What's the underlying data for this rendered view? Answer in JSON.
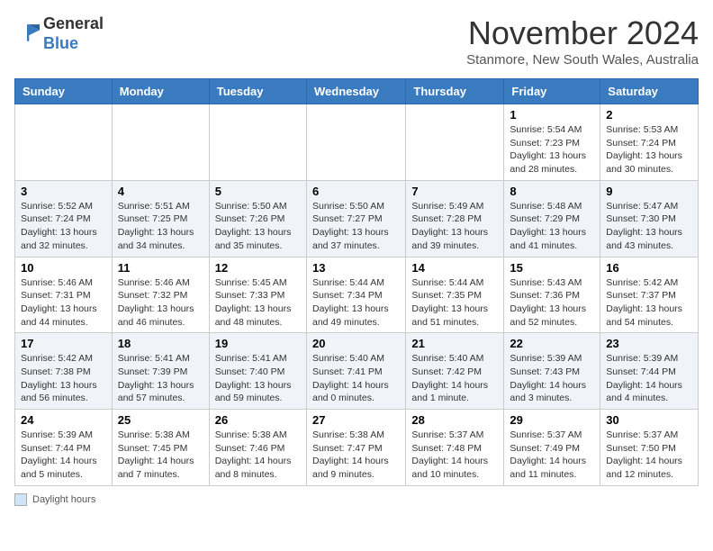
{
  "logo": {
    "text_general": "General",
    "text_blue": "Blue"
  },
  "header": {
    "month_year": "November 2024",
    "location": "Stanmore, New South Wales, Australia"
  },
  "days_of_week": [
    "Sunday",
    "Monday",
    "Tuesday",
    "Wednesday",
    "Thursday",
    "Friday",
    "Saturday"
  ],
  "weeks": [
    [
      {
        "day": "",
        "sunrise": "",
        "sunset": "",
        "daylight": ""
      },
      {
        "day": "",
        "sunrise": "",
        "sunset": "",
        "daylight": ""
      },
      {
        "day": "",
        "sunrise": "",
        "sunset": "",
        "daylight": ""
      },
      {
        "day": "",
        "sunrise": "",
        "sunset": "",
        "daylight": ""
      },
      {
        "day": "",
        "sunrise": "",
        "sunset": "",
        "daylight": ""
      },
      {
        "day": "1",
        "sunrise": "Sunrise: 5:54 AM",
        "sunset": "Sunset: 7:23 PM",
        "daylight": "Daylight: 13 hours and 28 minutes."
      },
      {
        "day": "2",
        "sunrise": "Sunrise: 5:53 AM",
        "sunset": "Sunset: 7:24 PM",
        "daylight": "Daylight: 13 hours and 30 minutes."
      }
    ],
    [
      {
        "day": "3",
        "sunrise": "Sunrise: 5:52 AM",
        "sunset": "Sunset: 7:24 PM",
        "daylight": "Daylight: 13 hours and 32 minutes."
      },
      {
        "day": "4",
        "sunrise": "Sunrise: 5:51 AM",
        "sunset": "Sunset: 7:25 PM",
        "daylight": "Daylight: 13 hours and 34 minutes."
      },
      {
        "day": "5",
        "sunrise": "Sunrise: 5:50 AM",
        "sunset": "Sunset: 7:26 PM",
        "daylight": "Daylight: 13 hours and 35 minutes."
      },
      {
        "day": "6",
        "sunrise": "Sunrise: 5:50 AM",
        "sunset": "Sunset: 7:27 PM",
        "daylight": "Daylight: 13 hours and 37 minutes."
      },
      {
        "day": "7",
        "sunrise": "Sunrise: 5:49 AM",
        "sunset": "Sunset: 7:28 PM",
        "daylight": "Daylight: 13 hours and 39 minutes."
      },
      {
        "day": "8",
        "sunrise": "Sunrise: 5:48 AM",
        "sunset": "Sunset: 7:29 PM",
        "daylight": "Daylight: 13 hours and 41 minutes."
      },
      {
        "day": "9",
        "sunrise": "Sunrise: 5:47 AM",
        "sunset": "Sunset: 7:30 PM",
        "daylight": "Daylight: 13 hours and 43 minutes."
      }
    ],
    [
      {
        "day": "10",
        "sunrise": "Sunrise: 5:46 AM",
        "sunset": "Sunset: 7:31 PM",
        "daylight": "Daylight: 13 hours and 44 minutes."
      },
      {
        "day": "11",
        "sunrise": "Sunrise: 5:46 AM",
        "sunset": "Sunset: 7:32 PM",
        "daylight": "Daylight: 13 hours and 46 minutes."
      },
      {
        "day": "12",
        "sunrise": "Sunrise: 5:45 AM",
        "sunset": "Sunset: 7:33 PM",
        "daylight": "Daylight: 13 hours and 48 minutes."
      },
      {
        "day": "13",
        "sunrise": "Sunrise: 5:44 AM",
        "sunset": "Sunset: 7:34 PM",
        "daylight": "Daylight: 13 hours and 49 minutes."
      },
      {
        "day": "14",
        "sunrise": "Sunrise: 5:44 AM",
        "sunset": "Sunset: 7:35 PM",
        "daylight": "Daylight: 13 hours and 51 minutes."
      },
      {
        "day": "15",
        "sunrise": "Sunrise: 5:43 AM",
        "sunset": "Sunset: 7:36 PM",
        "daylight": "Daylight: 13 hours and 52 minutes."
      },
      {
        "day": "16",
        "sunrise": "Sunrise: 5:42 AM",
        "sunset": "Sunset: 7:37 PM",
        "daylight": "Daylight: 13 hours and 54 minutes."
      }
    ],
    [
      {
        "day": "17",
        "sunrise": "Sunrise: 5:42 AM",
        "sunset": "Sunset: 7:38 PM",
        "daylight": "Daylight: 13 hours and 56 minutes."
      },
      {
        "day": "18",
        "sunrise": "Sunrise: 5:41 AM",
        "sunset": "Sunset: 7:39 PM",
        "daylight": "Daylight: 13 hours and 57 minutes."
      },
      {
        "day": "19",
        "sunrise": "Sunrise: 5:41 AM",
        "sunset": "Sunset: 7:40 PM",
        "daylight": "Daylight: 13 hours and 59 minutes."
      },
      {
        "day": "20",
        "sunrise": "Sunrise: 5:40 AM",
        "sunset": "Sunset: 7:41 PM",
        "daylight": "Daylight: 14 hours and 0 minutes."
      },
      {
        "day": "21",
        "sunrise": "Sunrise: 5:40 AM",
        "sunset": "Sunset: 7:42 PM",
        "daylight": "Daylight: 14 hours and 1 minute."
      },
      {
        "day": "22",
        "sunrise": "Sunrise: 5:39 AM",
        "sunset": "Sunset: 7:43 PM",
        "daylight": "Daylight: 14 hours and 3 minutes."
      },
      {
        "day": "23",
        "sunrise": "Sunrise: 5:39 AM",
        "sunset": "Sunset: 7:44 PM",
        "daylight": "Daylight: 14 hours and 4 minutes."
      }
    ],
    [
      {
        "day": "24",
        "sunrise": "Sunrise: 5:39 AM",
        "sunset": "Sunset: 7:44 PM",
        "daylight": "Daylight: 14 hours and 5 minutes."
      },
      {
        "day": "25",
        "sunrise": "Sunrise: 5:38 AM",
        "sunset": "Sunset: 7:45 PM",
        "daylight": "Daylight: 14 hours and 7 minutes."
      },
      {
        "day": "26",
        "sunrise": "Sunrise: 5:38 AM",
        "sunset": "Sunset: 7:46 PM",
        "daylight": "Daylight: 14 hours and 8 minutes."
      },
      {
        "day": "27",
        "sunrise": "Sunrise: 5:38 AM",
        "sunset": "Sunset: 7:47 PM",
        "daylight": "Daylight: 14 hours and 9 minutes."
      },
      {
        "day": "28",
        "sunrise": "Sunrise: 5:37 AM",
        "sunset": "Sunset: 7:48 PM",
        "daylight": "Daylight: 14 hours and 10 minutes."
      },
      {
        "day": "29",
        "sunrise": "Sunrise: 5:37 AM",
        "sunset": "Sunset: 7:49 PM",
        "daylight": "Daylight: 14 hours and 11 minutes."
      },
      {
        "day": "30",
        "sunrise": "Sunrise: 5:37 AM",
        "sunset": "Sunset: 7:50 PM",
        "daylight": "Daylight: 14 hours and 12 minutes."
      }
    ]
  ],
  "legend": {
    "label": "Daylight hours"
  },
  "colors": {
    "header_bg": "#3a7abf",
    "even_row_bg": "#f0f4f8",
    "odd_row_bg": "#ffffff"
  }
}
